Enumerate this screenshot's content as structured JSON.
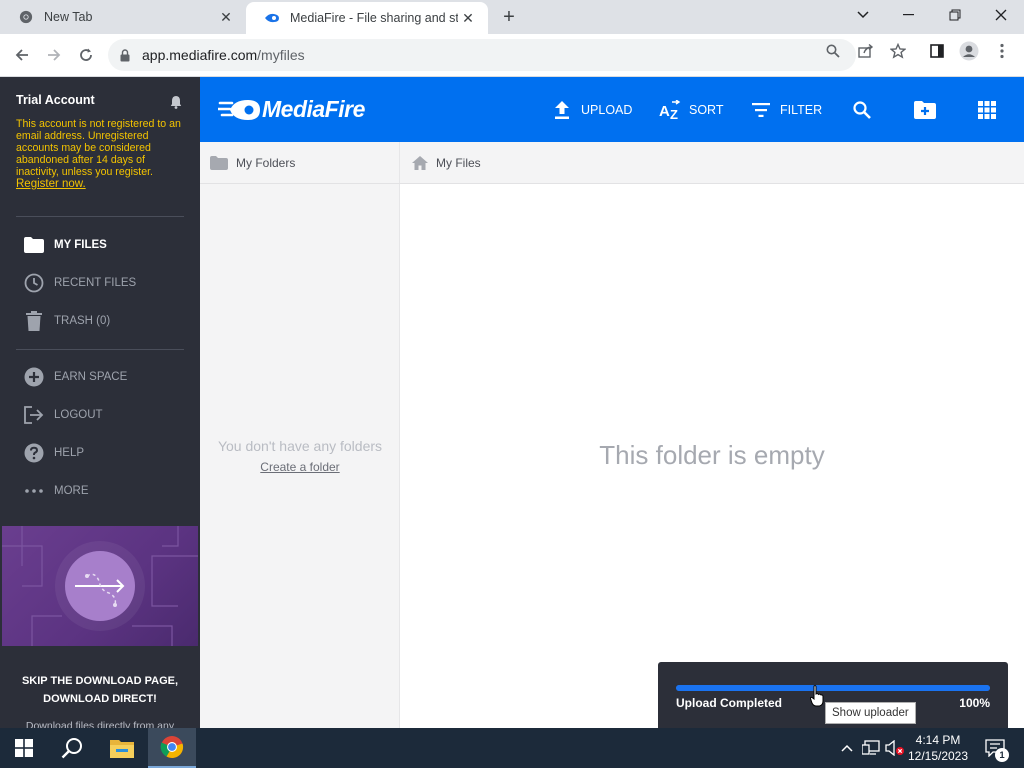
{
  "browser": {
    "tabs": [
      {
        "title": "New Tab",
        "icon": "chrome-icon"
      },
      {
        "title": "MediaFire - File sharing and stor",
        "icon": "mediafire-favicon"
      }
    ],
    "new_tab_symbol": "+",
    "url_host": "app.mediafire.com",
    "url_path": "/myfiles"
  },
  "sidebar": {
    "account_title": "Trial Account",
    "warning_text": "This account is not registered to an email address. Unregistered accounts may be considered abandoned after 14 days of inactivity, unless you register.",
    "register_link": "Register now.",
    "items": [
      {
        "label": "MY FILES",
        "icon": "folder-icon"
      },
      {
        "label": "RECENT FILES",
        "icon": "clock-icon"
      },
      {
        "label": "TRASH (0)",
        "icon": "trash-icon"
      },
      {
        "label": "EARN SPACE",
        "icon": "plus-circle-icon"
      },
      {
        "label": "LOGOUT",
        "icon": "logout-icon"
      },
      {
        "label": "HELP",
        "icon": "help-icon"
      },
      {
        "label": "MORE",
        "icon": "more-icon"
      }
    ],
    "promo_title_line1": "SKIP THE DOWNLOAD PAGE,",
    "promo_title_line2": "DOWNLOAD DIRECT!",
    "promo_sub": "Download files directly from any"
  },
  "topbar": {
    "logo": "MediaFire",
    "upload": "UPLOAD",
    "sort": "SORT",
    "filter": "FILTER"
  },
  "folders": {
    "header": "My Folders",
    "empty": "You don't have any folders",
    "create": "Create a folder"
  },
  "files": {
    "breadcrumb": "My Files",
    "empty": "This folder is empty"
  },
  "uploader": {
    "status": "Upload Completed",
    "percent_label": "100%",
    "progress": 1.0,
    "tooltip": "Show uploader"
  },
  "taskbar": {
    "time": "4:14 PM",
    "date": "12/15/2023",
    "notification_count": "1"
  },
  "colors": {
    "mediafire_blue": "#0070f0",
    "sidebar_bg": "#2c2f39",
    "warning_yellow": "#f3c300"
  }
}
